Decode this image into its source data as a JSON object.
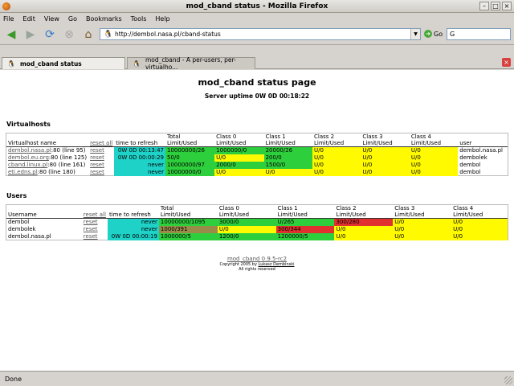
{
  "window": {
    "title": "mod_cband status - Mozilla Firefox",
    "btn_min": "–",
    "btn_max": "□",
    "btn_close": "×"
  },
  "menu": [
    "File",
    "Edit",
    "View",
    "Go",
    "Bookmarks",
    "Tools",
    "Help"
  ],
  "nav": {
    "url": "http://dembol.nasa.pl/cband-status",
    "go_label": "Go",
    "search_value": "G"
  },
  "tabs": [
    {
      "label": "mod_cband status"
    },
    {
      "label": "mod_cband - A per-users, per-virtualho..."
    }
  ],
  "page": {
    "title": "mod_cband status page",
    "uptime": "Server uptime 0W 0D 00:18:22"
  },
  "virtualhosts": {
    "section_title": "Virtualhosts",
    "headers": {
      "name": "Virtualhost name",
      "reset_all": "reset all",
      "refresh": "time to refresh",
      "total": [
        "Total",
        "Limit/Used"
      ],
      "class0": [
        "Class 0",
        "Limit/Used"
      ],
      "class1": [
        "Class 1",
        "Limit/Used"
      ],
      "class2": [
        "Class 2",
        "Limit/Used"
      ],
      "class3": [
        "Class 3",
        "Limit/Used"
      ],
      "class4": [
        "Class 4",
        "Limit/Used"
      ],
      "user": "user"
    },
    "rows": [
      {
        "host": "dembol.nasa.pl",
        "info": ":80 (line 95)",
        "reset": "reset",
        "refresh": "0W 0D 00:13:47",
        "total": "10000000/26",
        "c0": "1000000/0",
        "c1": "20000/26",
        "c2": "U/0",
        "c3": "U/0",
        "c4": "U/0",
        "user": "dembol.nasa.pl"
      },
      {
        "host": "dembol.eu.org",
        "info": ":80 (line 125)",
        "reset": "reset",
        "refresh": "0W 0D 00:00:29",
        "total": "50/0",
        "c0": "U/0",
        "c1": "200/0",
        "c2": "U/0",
        "c3": "U/0",
        "c4": "U/0",
        "user": "dembolek"
      },
      {
        "host": "cband.linux.pl",
        "info": ":80 (line 161)",
        "reset": "reset",
        "refresh": "never",
        "total": "10000000/97",
        "c0": "2000/0",
        "c1": "1500/0",
        "c2": "U/0",
        "c3": "U/0",
        "c4": "U/0",
        "user": "dembol"
      },
      {
        "host": "eti.edns.pl",
        "info": ":80 (line 180)",
        "reset": "reset",
        "refresh": "never",
        "total": "10000000/0",
        "c0": "U/0",
        "c1": "U/0",
        "c2": "U/0",
        "c3": "U/0",
        "c4": "U/0",
        "user": "dembol"
      }
    ]
  },
  "users": {
    "section_title": "Users",
    "headers": {
      "name": "Username",
      "reset_all": "reset all",
      "refresh": "time to refresh",
      "total": [
        "Total",
        "Limit/Used"
      ],
      "class0": [
        "Class 0",
        "Limit/Used"
      ],
      "class1": [
        "Class 1",
        "Limit/Used"
      ],
      "class2": [
        "Class 2",
        "Limit/Used"
      ],
      "class3": [
        "Class 3",
        "Limit/Used"
      ],
      "class4": [
        "Class 4",
        "Limit/Used"
      ]
    },
    "rows": [
      {
        "name": "dembol",
        "reset": "reset",
        "refresh": "never",
        "total": "10000000/1095",
        "c0": "3000/0",
        "c1": "U/265",
        "c2": "300/280",
        "c3": "U/0",
        "c4": "U/0"
      },
      {
        "name": "dembolek",
        "reset": "reset",
        "refresh": "never",
        "total": "1000/391",
        "c0": "U/0",
        "c1": "300/344",
        "c2": "U/0",
        "c3": "U/0",
        "c4": "U/0"
      },
      {
        "name": "dembol.nasa.pl",
        "reset": "reset",
        "refresh": "0W 0D 00:00:19",
        "total": "1000000/5",
        "c0": "1200/0",
        "c1": "1200000/5",
        "c2": "U/0",
        "c3": "U/0",
        "c4": "U/0"
      }
    ]
  },
  "footer": {
    "link": "mod_cband 0.9.5-rc2",
    "copyright_prefix": "Copyright 2005 by",
    "author": "Lukasz Dembinski",
    "rights": "All rights reserved"
  },
  "status": "Done",
  "colors": {
    "cyan": "#1ed2c8",
    "green": "#2ecf3c",
    "yellow": "#fffa00",
    "red": "#e13030",
    "olive": "#9b8b4a"
  }
}
